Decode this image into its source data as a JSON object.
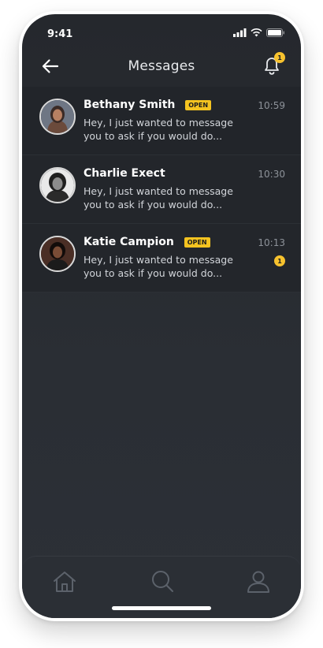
{
  "status_bar": {
    "time": "9:41"
  },
  "header": {
    "title": "Messages",
    "notification_count": "1"
  },
  "conversations": [
    {
      "name": "Bethany Smith",
      "badge": "OPEN",
      "preview": "Hey, I just wanted to message you to ask if you would do...",
      "time": "10:59",
      "unread": ""
    },
    {
      "name": "Charlie Exect",
      "badge": "",
      "preview": "Hey, I just wanted to message you to ask if you would do...",
      "time": "10:30",
      "unread": ""
    },
    {
      "name": "Katie Campion",
      "badge": "OPEN",
      "preview": "Hey, I just wanted to message you to ask if you would do...",
      "time": "10:13",
      "unread": "1"
    }
  ],
  "tab_bar": {
    "icons": [
      "home-icon",
      "search-icon",
      "profile-icon"
    ]
  },
  "colors": {
    "accent": "#f7c22e",
    "background": "#25282d",
    "text": "#ffffff"
  }
}
